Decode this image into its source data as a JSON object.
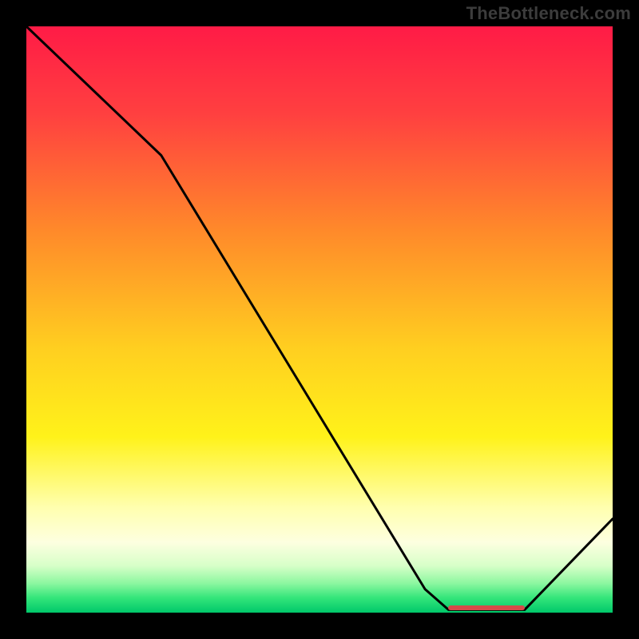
{
  "watermark": "TheBottleneck.com",
  "chart_data": {
    "type": "line",
    "title": "",
    "xlabel": "",
    "ylabel": "",
    "xlim": [
      0,
      100
    ],
    "ylim": [
      0,
      100
    ],
    "series": [
      {
        "name": "curve",
        "points": [
          {
            "x": 0,
            "y": 100
          },
          {
            "x": 23,
            "y": 78
          },
          {
            "x": 68,
            "y": 4
          },
          {
            "x": 72,
            "y": 0.5
          },
          {
            "x": 85,
            "y": 0.5
          },
          {
            "x": 100,
            "y": 16
          }
        ]
      }
    ],
    "marker": {
      "x_start": 72,
      "x_end": 85,
      "y": 0.5,
      "color": "#d64b49"
    },
    "gradient_stops": [
      {
        "offset": 0.0,
        "color": "#ff1b46"
      },
      {
        "offset": 0.15,
        "color": "#ff4040"
      },
      {
        "offset": 0.35,
        "color": "#ff8a2a"
      },
      {
        "offset": 0.55,
        "color": "#ffcf20"
      },
      {
        "offset": 0.7,
        "color": "#fff21a"
      },
      {
        "offset": 0.82,
        "color": "#ffffae"
      },
      {
        "offset": 0.88,
        "color": "#fdffe0"
      },
      {
        "offset": 0.92,
        "color": "#d7ffc8"
      },
      {
        "offset": 0.95,
        "color": "#8cf7a0"
      },
      {
        "offset": 0.975,
        "color": "#33e57a"
      },
      {
        "offset": 1.0,
        "color": "#00c86a"
      }
    ]
  }
}
